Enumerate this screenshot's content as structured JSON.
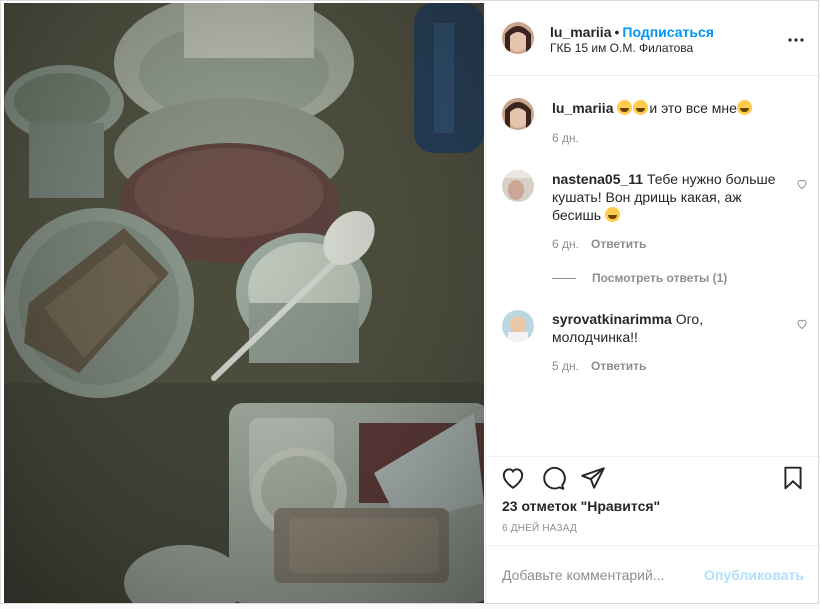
{
  "post": {
    "author": {
      "username": "lu_mariia",
      "follow_label": "Подписаться",
      "separator": "•",
      "location": "ГКБ 15 им О.М. Филатова"
    },
    "more_icon": "ellipsis-icon",
    "caption": {
      "username": "lu_mariia",
      "text": "и это все мне",
      "time": "6 дн."
    },
    "comments": [
      {
        "username": "nastena05_11",
        "text": "Тебе нужно больше кушать! Вон дрищь какая, аж бесишь",
        "time": "6 дн.",
        "reply_label": "Ответить",
        "view_replies": "Посмотреть ответы (1)"
      },
      {
        "username": "syrovatkinarimma",
        "text": "Ого, молодчинка!!",
        "time": "5 дн.",
        "reply_label": "Ответить"
      }
    ],
    "actions": {
      "like_icon": "heart-icon",
      "comment_icon": "comment-icon",
      "share_icon": "paper-plane-icon",
      "save_icon": "bookmark-icon"
    },
    "likes_text": "23 отметок \"Нравится\"",
    "date_text": "6 ДНЕЙ НАЗАД",
    "add_comment": {
      "placeholder": "Добавьте комментарий...",
      "publish_label": "Опубликовать"
    },
    "colors": {
      "link_blue": "#0095f6",
      "publish_disabled": "#b2dffc",
      "muted": "#8e8e8e"
    }
  }
}
